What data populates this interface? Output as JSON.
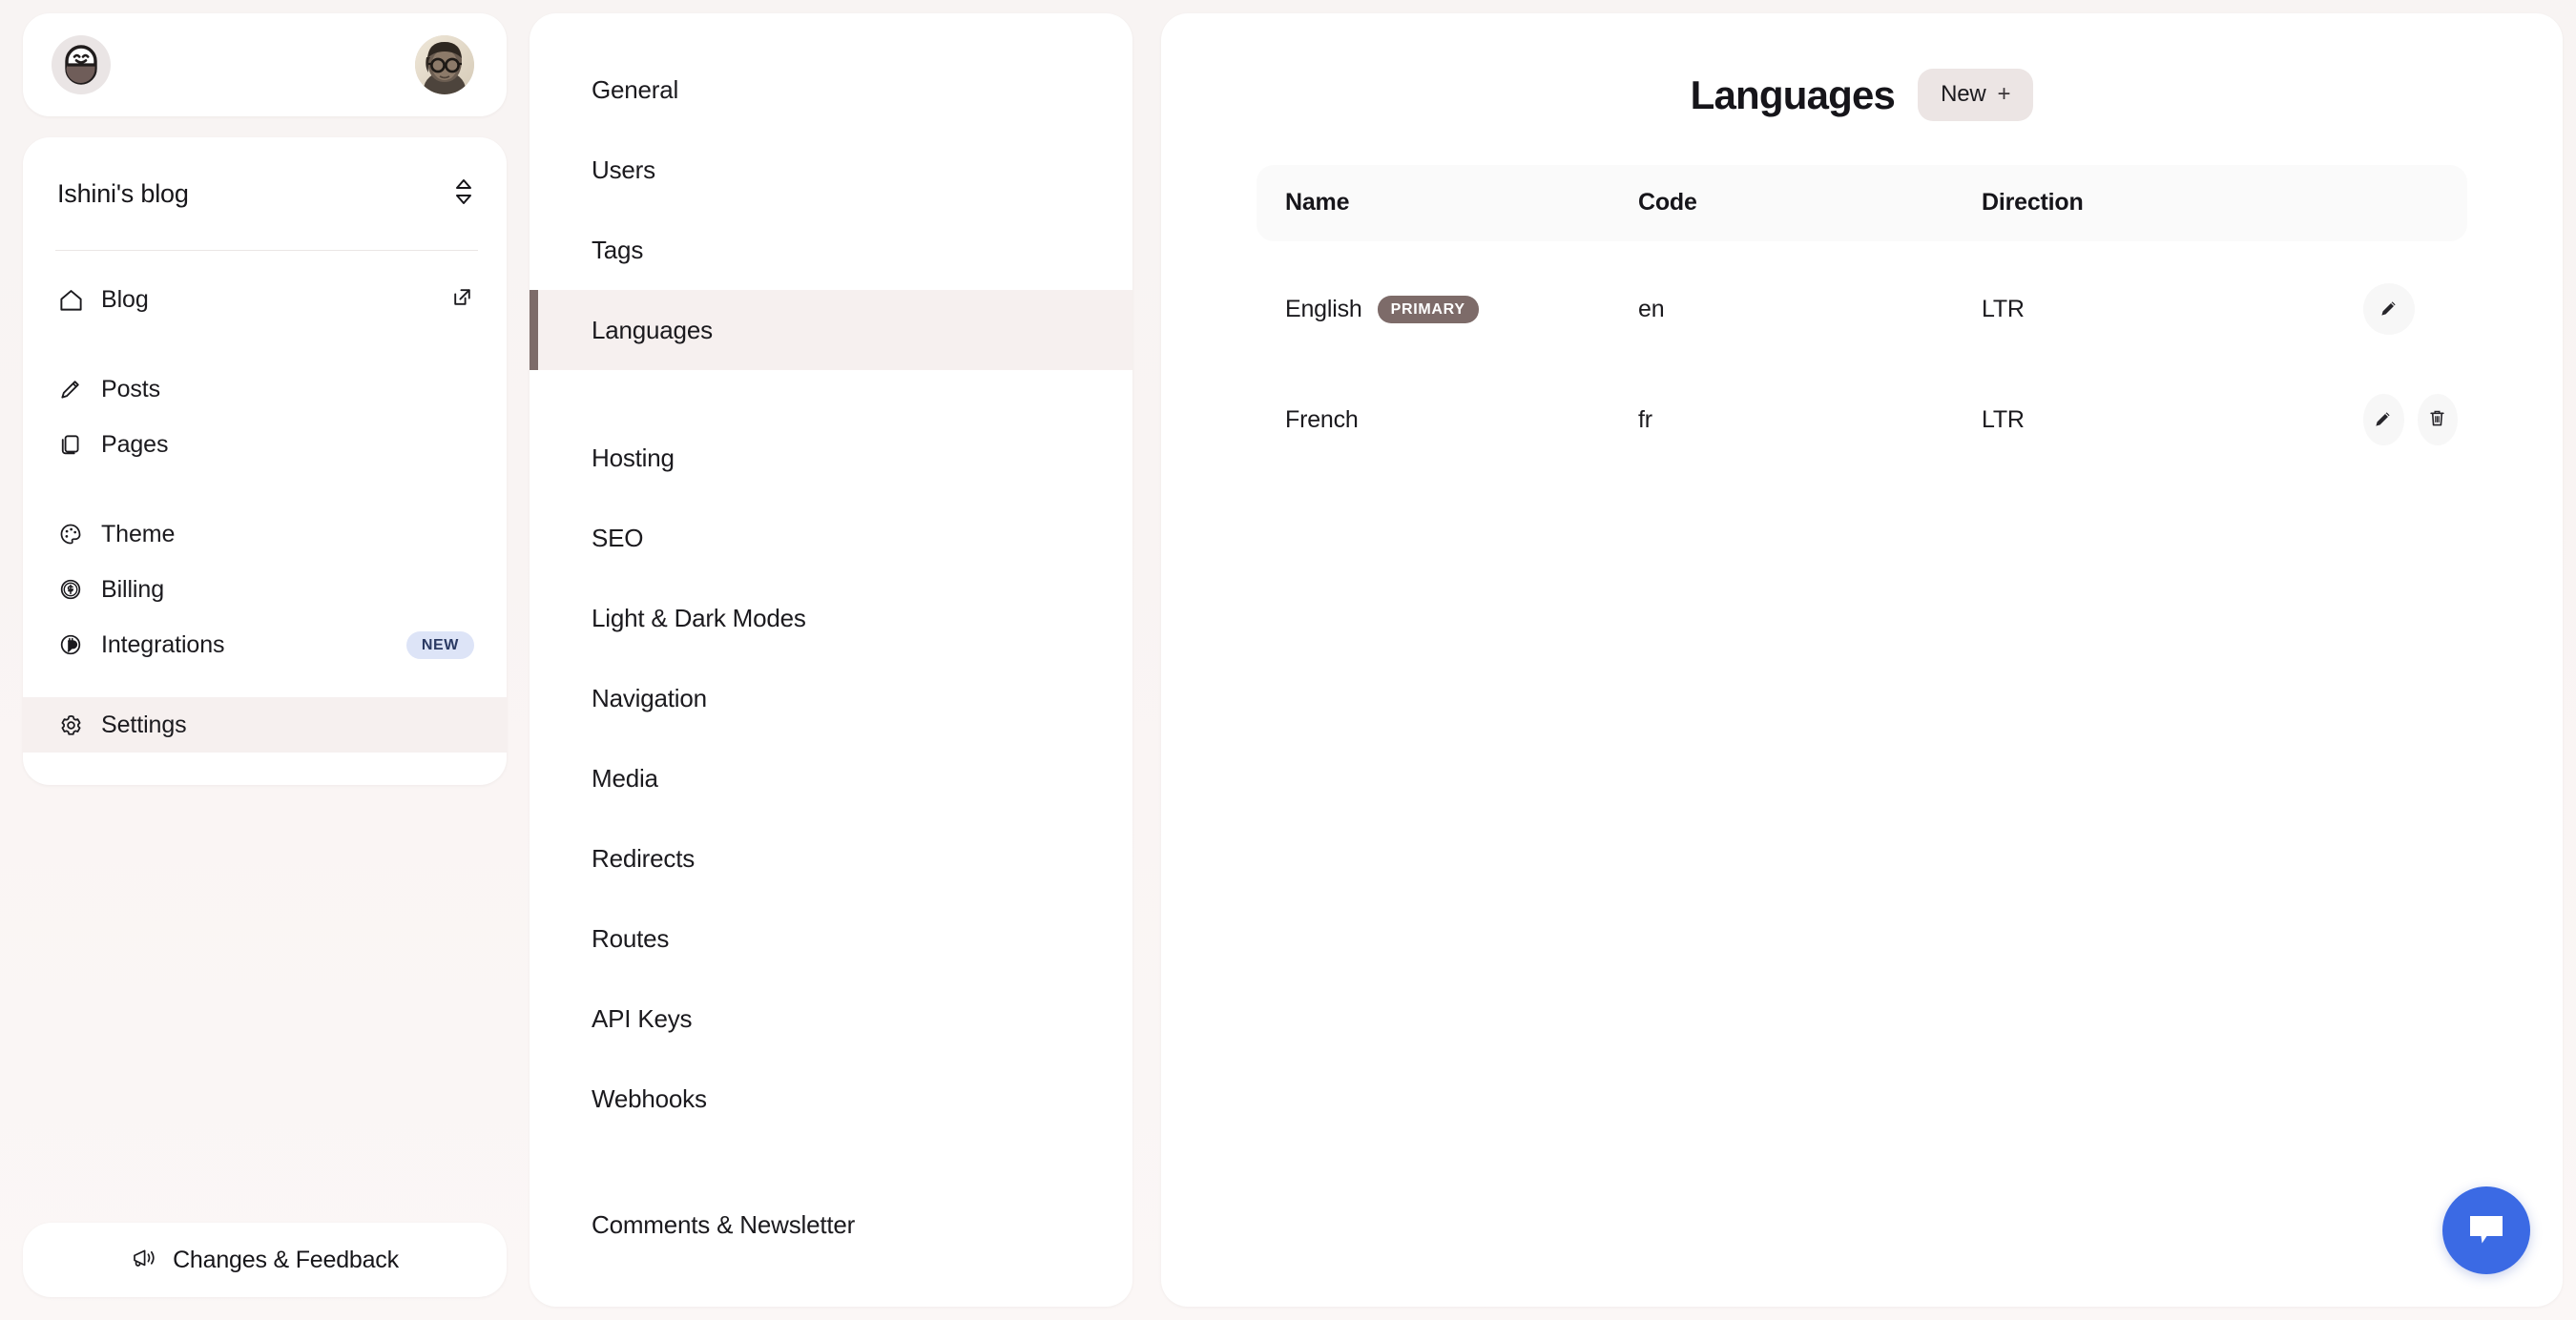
{
  "brand": {
    "logo_icon": "capsule-smiley-logo",
    "avatar_alt": "user-avatar"
  },
  "sidebar": {
    "blog_switcher": {
      "title": "Ishini's blog",
      "chevron_icon": "chevron-updown-icon"
    },
    "primary_items": [
      {
        "label": "Blog",
        "icon": "home-icon",
        "trailing_icon": "external-link-icon",
        "active": false
      },
      {
        "label": "Posts",
        "icon": "pencil-icon",
        "active": false
      },
      {
        "label": "Pages",
        "icon": "pages-icon",
        "active": false
      },
      {
        "label": "Theme",
        "icon": "palette-icon",
        "active": false
      },
      {
        "label": "Billing",
        "icon": "coin-dollar-icon",
        "active": false
      },
      {
        "label": "Integrations",
        "icon": "plug-icon",
        "badge": "NEW",
        "active": false
      },
      {
        "label": "Settings",
        "icon": "gear-icon",
        "active": true
      }
    ],
    "feedback": {
      "label": "Changes & Feedback",
      "icon": "megaphone-icon"
    }
  },
  "settings_nav": {
    "items": [
      {
        "label": "General",
        "active": false
      },
      {
        "label": "Users",
        "active": false
      },
      {
        "label": "Tags",
        "active": false
      },
      {
        "label": "Languages",
        "active": true
      },
      {
        "label": "Hosting",
        "active": false
      },
      {
        "label": "SEO",
        "active": false
      },
      {
        "label": "Light & Dark Modes",
        "active": false
      },
      {
        "label": "Navigation",
        "active": false
      },
      {
        "label": "Media",
        "active": false
      },
      {
        "label": "Redirects",
        "active": false
      },
      {
        "label": "Routes",
        "active": false
      },
      {
        "label": "API Keys",
        "active": false
      },
      {
        "label": "Webhooks",
        "active": false
      },
      {
        "label": "Comments & Newsletter",
        "active": false
      }
    ]
  },
  "main": {
    "title": "Languages",
    "new_button": {
      "label": "New",
      "plus": "+"
    },
    "table": {
      "columns": [
        "Name",
        "Code",
        "Direction",
        ""
      ],
      "rows": [
        {
          "name": "English",
          "badge": "PRIMARY",
          "code": "en",
          "direction": "LTR",
          "actions": [
            "edit-icon"
          ]
        },
        {
          "name": "French",
          "badge": "",
          "code": "fr",
          "direction": "LTR",
          "actions": [
            "edit-icon",
            "delete-icon"
          ]
        }
      ]
    }
  },
  "chat": {
    "icon": "chat-bubble-icon"
  },
  "colors": {
    "accent_bar": "#7d6b69",
    "active_bg": "#f6f0ef",
    "badge_new_bg": "#dde4f7",
    "badge_new_text": "#2b3a63",
    "badge_primary_bg": "#7d6b69",
    "chat_blue": "#3b6ae4",
    "page_bg": "#f9f4f3",
    "new_button_bg": "#ece5e4"
  }
}
